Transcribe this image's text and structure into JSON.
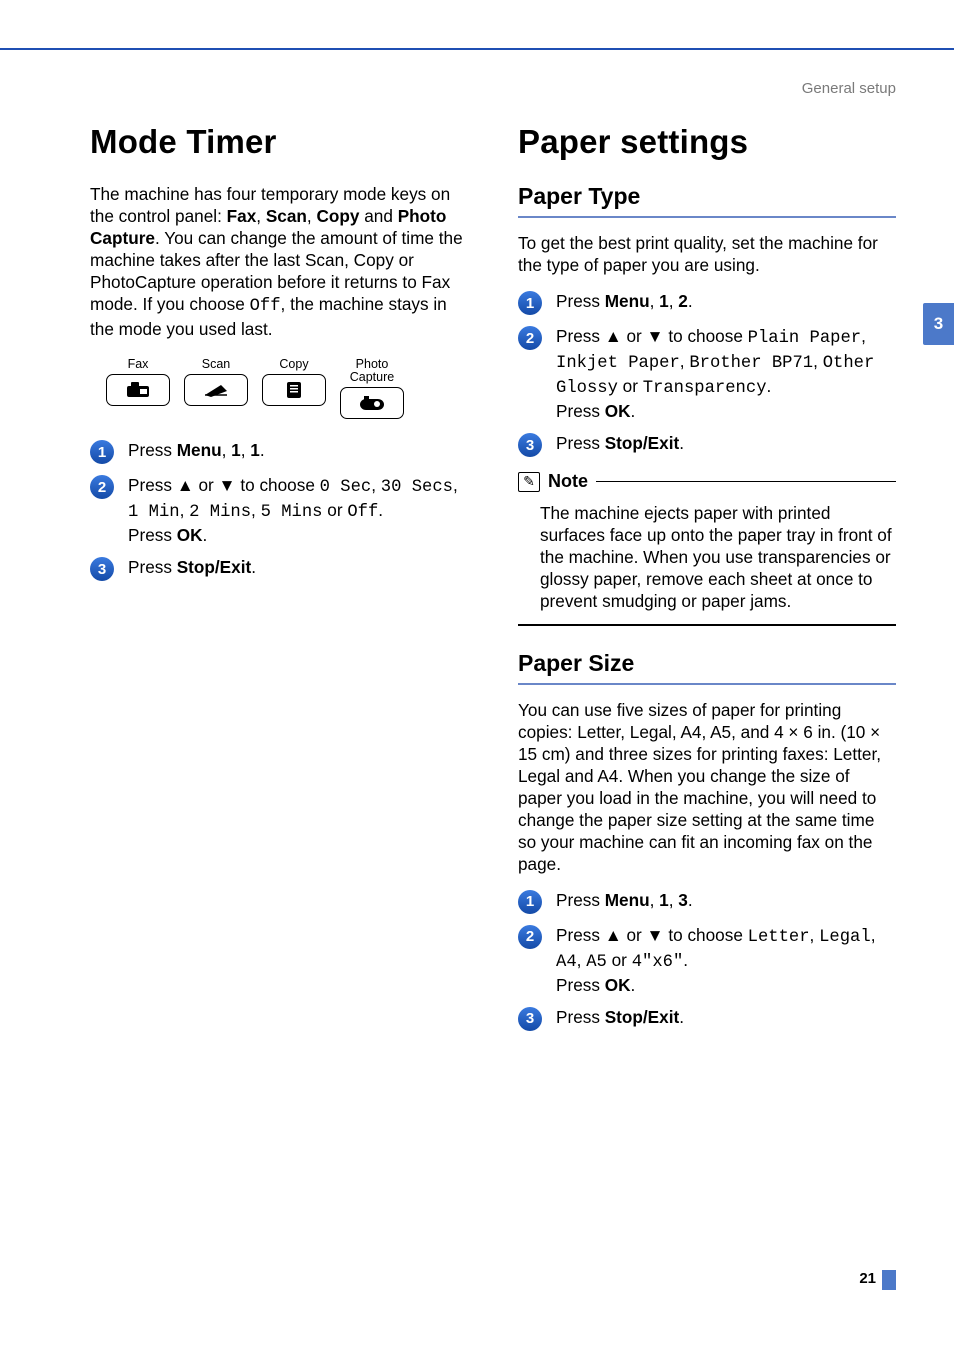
{
  "header": {
    "section": "General setup"
  },
  "tab": {
    "label": "3"
  },
  "page_number": "21",
  "left": {
    "title": "Mode Timer",
    "intro_parts": {
      "p1a": "The machine has four temporary mode keys on the control panel: ",
      "k1": "Fax",
      "c1": ", ",
      "k2": "Scan",
      "c2": ", ",
      "k3": "Copy",
      "c3": " and ",
      "k4": "Photo Capture",
      "p1b": ". You can change the amount of time the machine takes after the last Scan, Copy or PhotoCapture operation before it returns to Fax mode. If you choose ",
      "off": "Off",
      "p1c": ", the machine stays in the mode you used last."
    },
    "panel": {
      "labels": [
        "Fax",
        "Scan",
        "Copy",
        "Photo\nCapture"
      ]
    },
    "steps": {
      "s1": {
        "n": "1",
        "pre": "Press ",
        "b1": "Menu",
        "mid1": ", ",
        "b2": "1",
        "mid2": ", ",
        "b3": "1",
        "end": "."
      },
      "s2": {
        "n": "2",
        "pre": "Press ▲ or ▼ to choose ",
        "opts": [
          "0 Sec",
          "30 Secs",
          "1 Min",
          "2 Mins",
          "5 Mins",
          "Off"
        ],
        "or": " or ",
        "sep": ", ",
        "dot": ".",
        "press": "Press ",
        "ok": "OK",
        "end": "."
      },
      "s3": {
        "n": "3",
        "pre": "Press ",
        "b1": "Stop/Exit",
        "end": "."
      }
    }
  },
  "right": {
    "title": "Paper settings",
    "paper_type": {
      "heading": "Paper Type",
      "intro": "To get the best print quality, set the machine for the type of paper you are using.",
      "s1": {
        "n": "1",
        "pre": "Press ",
        "b1": "Menu",
        "mid1": ", ",
        "b2": "1",
        "mid2": ", ",
        "b3": "2",
        "end": "."
      },
      "s2": {
        "n": "2",
        "pre": "Press ▲ or ▼ to choose ",
        "opts": [
          "Plain Paper",
          "Inkjet Paper",
          "Brother BP71",
          "Other Glossy",
          "Transparency"
        ],
        "or": " or ",
        "sep": ", ",
        "dot": ".",
        "press": "Press ",
        "ok": "OK",
        "end": "."
      },
      "s3": {
        "n": "3",
        "pre": "Press ",
        "b1": "Stop/Exit",
        "end": "."
      },
      "note": {
        "label": "Note",
        "body": "The machine ejects paper with printed surfaces face up onto the paper tray in front of the machine. When you use transparencies or glossy paper, remove each sheet at once to prevent smudging or paper jams."
      }
    },
    "paper_size": {
      "heading": "Paper Size",
      "intro": "You can use five sizes of paper for printing copies: Letter, Legal, A4, A5, and 4 × 6 in. (10 × 15 cm) and three sizes for printing faxes: Letter, Legal and A4. When you change the size of paper you load in the machine, you will need to change the paper size setting at the same time so your machine can fit an incoming fax on the page.",
      "s1": {
        "n": "1",
        "pre": "Press ",
        "b1": "Menu",
        "mid1": ", ",
        "b2": "1",
        "mid2": ", ",
        "b3": "3",
        "end": "."
      },
      "s2": {
        "n": "2",
        "pre": "Press ▲ or ▼ to choose ",
        "opts": [
          "Letter",
          "Legal",
          "A4",
          "A5",
          "4\"x6\""
        ],
        "or": " or ",
        "sep": ", ",
        "dot": ".",
        "press": "Press ",
        "ok": "OK",
        "end": "."
      },
      "s3": {
        "n": "3",
        "pre": "Press ",
        "b1": "Stop/Exit",
        "end": "."
      }
    }
  }
}
